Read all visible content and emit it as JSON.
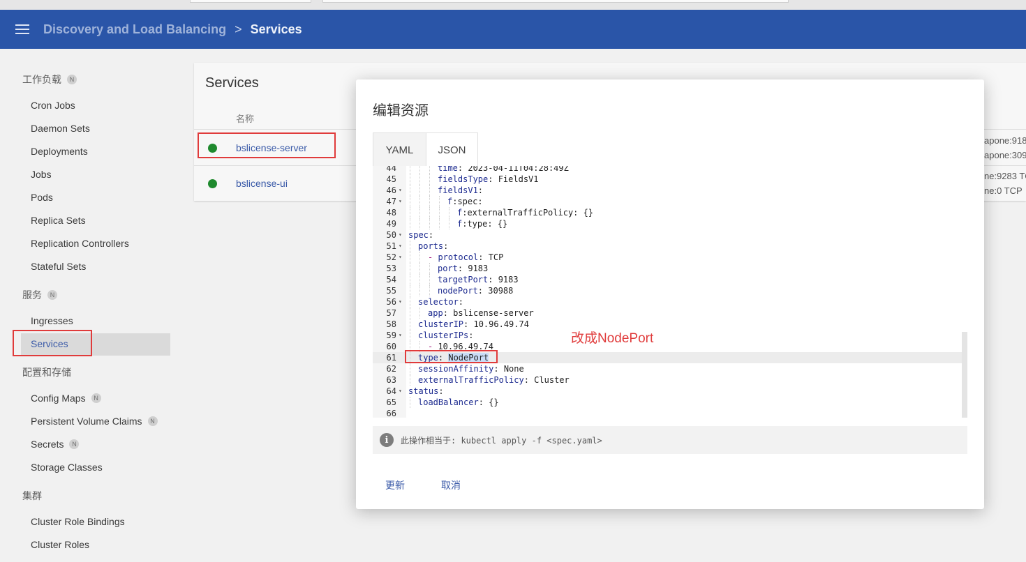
{
  "header": {
    "parent": "Discovery and Load Balancing",
    "separator": ">",
    "current": "Services"
  },
  "sidebar": {
    "sections": [
      {
        "label": "工作负载",
        "badge": "N",
        "items": [
          "Cron Jobs",
          "Daemon Sets",
          "Deployments",
          "Jobs",
          "Pods",
          "Replica Sets",
          "Replication Controllers",
          "Stateful Sets"
        ]
      },
      {
        "label": "服务",
        "badge": "N",
        "items": [
          "Ingresses",
          "Services"
        ]
      },
      {
        "label": "配置和存储",
        "items": [
          "Config Maps",
          "Persistent Volume Claims",
          "Secrets",
          "Storage Classes"
        ],
        "badges": {
          "Config Maps": "N",
          "Persistent Volume Claims": "N",
          "Secrets": "N"
        }
      },
      {
        "label": "集群",
        "items": [
          "Cluster Role Bindings",
          "Cluster Roles"
        ]
      }
    ],
    "active_item": "Services"
  },
  "card": {
    "title": "Services",
    "column_name": "名称",
    "rows": [
      {
        "name": "bslicense-server",
        "status_color": "#1f8a2e"
      },
      {
        "name": "bslicense-ui",
        "status_color": "#1f8a2e"
      }
    ],
    "right_texts": [
      "apone:918",
      "apone:309",
      "ne:9283 TC",
      "ne:0 TCP"
    ]
  },
  "dialog": {
    "title": "编辑资源",
    "tabs": [
      "YAML",
      "JSON"
    ],
    "active_tab": "JSON",
    "lines": [
      {
        "n": "44",
        "fold": false,
        "indent": 3,
        "text": "time: 2023-04-11T04:28:49Z"
      },
      {
        "n": "45",
        "fold": false,
        "indent": 3,
        "text": "fieldsType: FieldsV1"
      },
      {
        "n": "46",
        "fold": true,
        "indent": 3,
        "text": "fieldsV1:"
      },
      {
        "n": "47",
        "fold": true,
        "indent": 4,
        "text": "f:spec:"
      },
      {
        "n": "48",
        "fold": false,
        "indent": 5,
        "text": "f:externalTrafficPolicy: {}"
      },
      {
        "n": "49",
        "fold": false,
        "indent": 5,
        "text": "f:type: {}"
      },
      {
        "n": "50",
        "fold": true,
        "indent": 0,
        "text": "spec:"
      },
      {
        "n": "51",
        "fold": true,
        "indent": 1,
        "text": "ports:"
      },
      {
        "n": "52",
        "fold": true,
        "indent": 2,
        "text": "- protocol: TCP"
      },
      {
        "n": "53",
        "fold": false,
        "indent": 3,
        "text": "port: 9183"
      },
      {
        "n": "54",
        "fold": false,
        "indent": 3,
        "text": "targetPort: 9183"
      },
      {
        "n": "55",
        "fold": false,
        "indent": 3,
        "text": "nodePort: 30988"
      },
      {
        "n": "56",
        "fold": true,
        "indent": 1,
        "text": "selector:"
      },
      {
        "n": "57",
        "fold": false,
        "indent": 2,
        "text": "app: bslicense-server"
      },
      {
        "n": "58",
        "fold": false,
        "indent": 1,
        "text": "clusterIP: 10.96.49.74"
      },
      {
        "n": "59",
        "fold": true,
        "indent": 1,
        "text": "clusterIPs:"
      },
      {
        "n": "60",
        "fold": false,
        "indent": 2,
        "text": "- 10.96.49.74"
      },
      {
        "n": "61",
        "fold": false,
        "indent": 1,
        "text": "type: NodePort"
      },
      {
        "n": "62",
        "fold": false,
        "indent": 1,
        "text": "sessionAffinity: None"
      },
      {
        "n": "63",
        "fold": false,
        "indent": 1,
        "text": "externalTrafficPolicy: Cluster"
      },
      {
        "n": "64",
        "fold": true,
        "indent": 0,
        "text": "status:"
      },
      {
        "n": "65",
        "fold": false,
        "indent": 1,
        "text": "loadBalancer: {}"
      },
      {
        "n": "66",
        "fold": false,
        "indent": 0,
        "text": ""
      }
    ],
    "highlight_line": "61",
    "info": "此操作相当于: kubectl apply -f <spec.yaml>",
    "update_label": "更新",
    "cancel_label": "取消"
  },
  "annotation": "改成NodePort"
}
